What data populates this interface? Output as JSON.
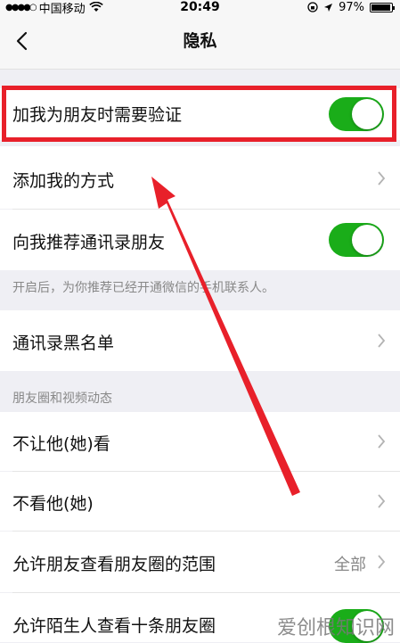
{
  "status_bar": {
    "carrier": "中国移动",
    "time": "20:49",
    "battery_percent": "97%",
    "battery_level": 0.97
  },
  "nav": {
    "title": "隐私",
    "back_icon": "chevron-left-icon"
  },
  "settings": {
    "require_verification": {
      "label": "加我为朋友时需要验证",
      "enabled": true
    },
    "add_me_methods": {
      "label": "添加我的方式"
    },
    "recommend_contacts": {
      "label": "向我推荐通讯录朋友",
      "enabled": true
    },
    "recommend_hint": "开启后，为你推荐已经开通微信的手机联系人。",
    "blacklist": {
      "label": "通讯录黑名单"
    },
    "moments_section_header": "朋友圈和视频动态",
    "hide_my_posts": {
      "label": "不让他(她)看"
    },
    "hide_their_posts": {
      "label": "不看他(她)"
    },
    "moments_range": {
      "label": "允许朋友查看朋友圈的范围",
      "value": "全部"
    },
    "stranger_ten_posts": {
      "label": "允许陌生人查看十条朋友圈",
      "enabled": true
    }
  },
  "watermark": "爱创根知识网",
  "colors": {
    "toggle_on": "#1aad19",
    "annotation_red": "#e8202a",
    "background": "#efeff4"
  }
}
